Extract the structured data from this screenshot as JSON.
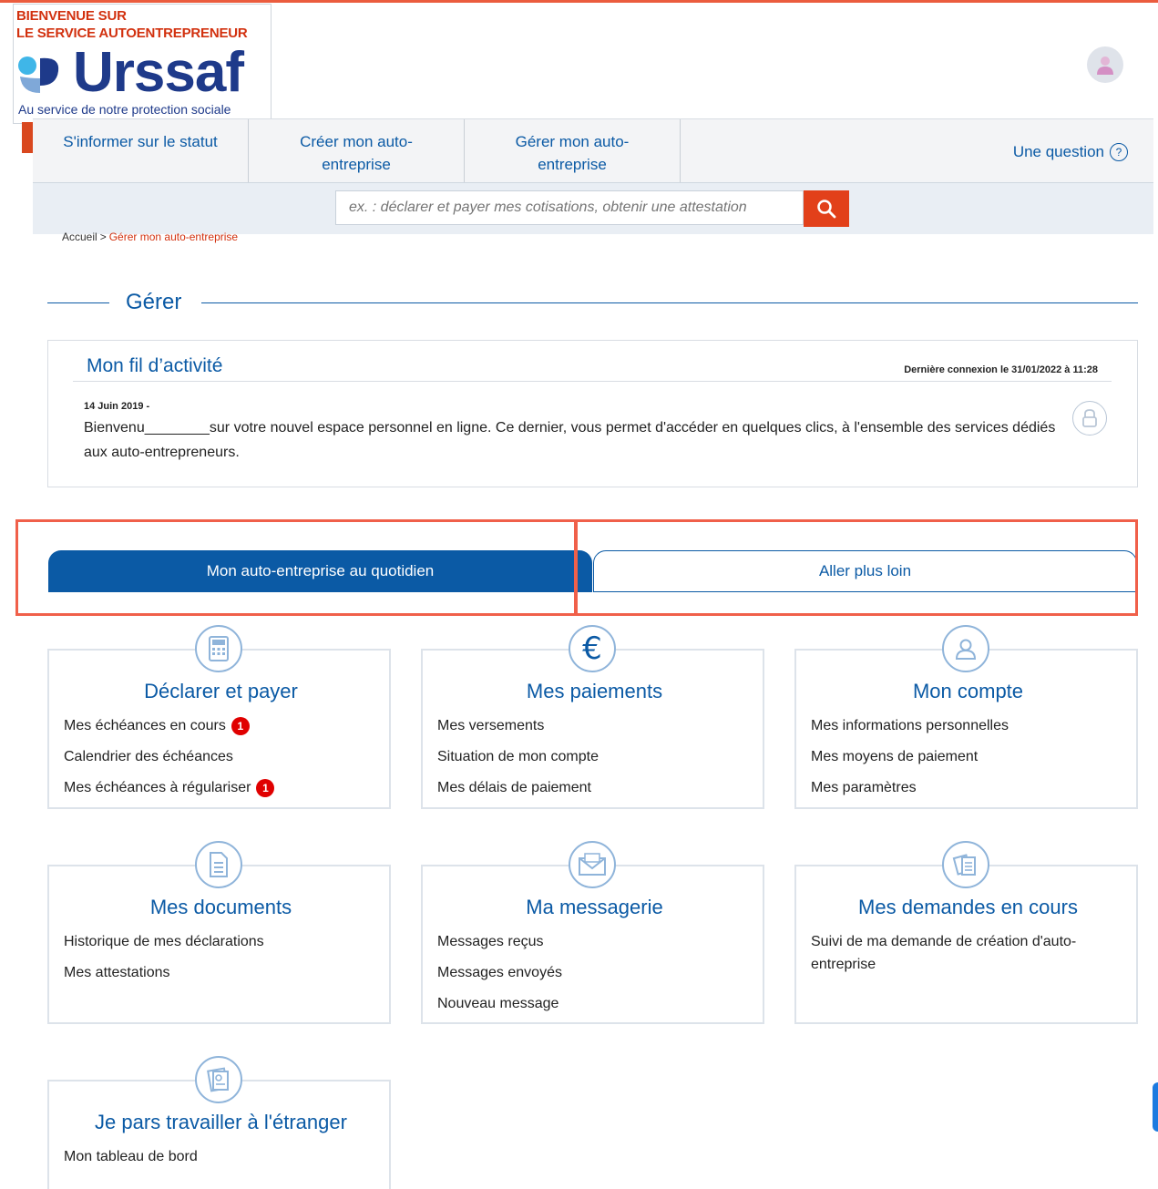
{
  "header": {
    "welcome_line1": "BIENVENUE SUR",
    "welcome_line2": "LE SERVICE AUTOENTREPRENEUR",
    "logo_word": "Urssaf",
    "logo_tagline": "Au service de notre protection sociale",
    "avatar_icon": "user-avatar-icon"
  },
  "nav": {
    "items": [
      {
        "label": "S'informer sur le statut"
      },
      {
        "label": "Créer mon auto-entreprise"
      },
      {
        "label": "Gérer mon auto-entreprise"
      }
    ],
    "question_label": "Une question",
    "question_icon": "?"
  },
  "search": {
    "placeholder": "ex. : déclarer et payer mes cotisations, obtenir une attestation",
    "button_icon": "search-icon"
  },
  "breadcrumb": {
    "home": "Accueil",
    "separator": ">",
    "current": "Gérer mon auto-entreprise"
  },
  "section": {
    "title": "Gérer"
  },
  "activity": {
    "title": "Mon fil d’activité",
    "last_login": "Dernière connexion le 31/01/2022 à 11:28",
    "entry_date": "14 Juin 2019 - ",
    "message": "Bienvenu________sur votre nouvel espace personnel en ligne. Ce dernier, vous permet d'accéder en quelques clics, à l'ensemble des services dédiés aux auto-entrepreneurs."
  },
  "tabs": {
    "active": "Mon auto-entreprise au quotidien",
    "inactive": "Aller plus loin"
  },
  "cards": [
    {
      "title": "Déclarer et payer",
      "icon": "calculator-icon",
      "links": [
        {
          "label": "Mes échéances en cours",
          "badge": "1"
        },
        {
          "label": "Calendrier des échéances"
        },
        {
          "label": "Mes échéances à régulariser",
          "badge": "1"
        }
      ]
    },
    {
      "title": "Mes paiements",
      "icon": "euro-icon",
      "links": [
        {
          "label": "Mes versements"
        },
        {
          "label": "Situation de mon compte"
        },
        {
          "label": "Mes délais de paiement"
        }
      ]
    },
    {
      "title": "Mon compte",
      "icon": "user-icon",
      "links": [
        {
          "label": "Mes informations personnelles"
        },
        {
          "label": "Mes moyens de paiement"
        },
        {
          "label": "Mes paramètres"
        }
      ]
    },
    {
      "title": "Mes documents",
      "icon": "document-icon",
      "links": [
        {
          "label": "Historique de mes déclarations"
        },
        {
          "label": "Mes attestations"
        }
      ]
    },
    {
      "title": "Ma messagerie",
      "icon": "envelope-icon",
      "links": [
        {
          "label": "Messages reçus"
        },
        {
          "label": "Messages envoyés"
        },
        {
          "label": "Nouveau message"
        }
      ]
    },
    {
      "title": "Mes demandes en cours",
      "icon": "files-icon",
      "links": [
        {
          "label": "Suivi de ma demande de création d'auto-entreprise"
        }
      ]
    },
    {
      "title": "Je pars travailler à l'étranger",
      "icon": "passport-icon",
      "links": [
        {
          "label": "Mon tableau de bord"
        }
      ]
    }
  ],
  "colors": {
    "brand_blue": "#0b5aa5",
    "accent_red": "#e2401a",
    "highlight_red": "#f0604a"
  }
}
